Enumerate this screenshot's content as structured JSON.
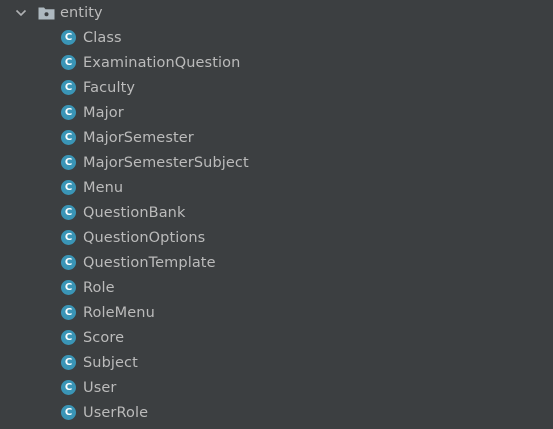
{
  "tree": {
    "folder": {
      "name": "entity",
      "expanded": true,
      "icon": "package-folder-icon"
    },
    "class_icon_letter": "C",
    "colors": {
      "background": "#3c3f41",
      "text": "#bbbbbb",
      "class_icon": "#3a95b6"
    },
    "items": [
      {
        "label": "Class"
      },
      {
        "label": "ExaminationQuestion"
      },
      {
        "label": "Faculty"
      },
      {
        "label": "Major"
      },
      {
        "label": "MajorSemester"
      },
      {
        "label": "MajorSemesterSubject"
      },
      {
        "label": "Menu"
      },
      {
        "label": "QuestionBank"
      },
      {
        "label": "QuestionOptions"
      },
      {
        "label": "QuestionTemplate"
      },
      {
        "label": "Role"
      },
      {
        "label": "RoleMenu"
      },
      {
        "label": "Score"
      },
      {
        "label": "Subject"
      },
      {
        "label": "User"
      },
      {
        "label": "UserRole"
      }
    ]
  }
}
